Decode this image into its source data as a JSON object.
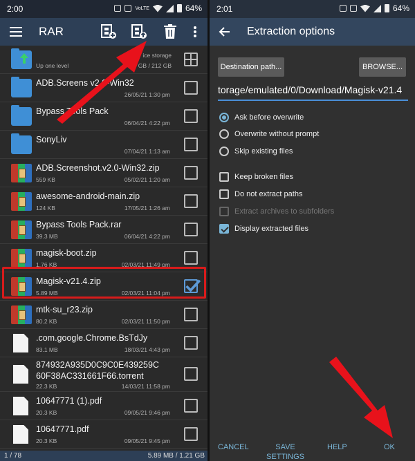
{
  "left": {
    "status": {
      "time": "2:00",
      "battery": "64%",
      "volte": "VoLTE"
    },
    "appbar": {
      "title": "RAR"
    },
    "files": [
      {
        "name": "",
        "sub": "Up one level",
        "info": "ice storage",
        "info2": "5 GB / 212 GB",
        "type": "up"
      },
      {
        "name": "ADB.Screens     v2.0-Win32",
        "sub": "",
        "date": "26/05/21 1:30 pm",
        "type": "folder"
      },
      {
        "name": "Bypass Tools Pack",
        "sub": "",
        "date": "06/04/21 4:22 pm",
        "type": "folder"
      },
      {
        "name": "SonyLiv",
        "sub": "",
        "date": "07/04/21 1:13 am",
        "type": "folder"
      },
      {
        "name": "ADB.Screenshot.v2.0-Win32.zip",
        "sub": "559 KB",
        "date": "05/02/21 1:20 am",
        "type": "rar"
      },
      {
        "name": "awesome-android-main.zip",
        "sub": "124 KB",
        "date": "17/05/21 1:26 am",
        "type": "rar"
      },
      {
        "name": "Bypass Tools Pack.rar",
        "sub": "39.3 MB",
        "date": "06/04/21 4:22 pm",
        "type": "rar"
      },
      {
        "name": "magisk-boot.zip",
        "sub": "1.76 KB",
        "date": "02/03/21 11:49 pm",
        "type": "rar"
      },
      {
        "name": "Magisk-v21.4.zip",
        "sub": "5.89 MB",
        "date": "02/03/21 11:04 pm",
        "type": "rar",
        "checked": true
      },
      {
        "name": "mtk-su_r23.zip",
        "sub": "80.2 KB",
        "date": "02/03/21 11:50 pm",
        "type": "rar"
      },
      {
        "name": ".com.google.Chrome.BsTdJy",
        "sub": "83.1 MB",
        "date": "18/03/21 4:43 pm",
        "type": "doc"
      },
      {
        "name": "874932A935D0C9C0E439259C",
        "name2": "60F38AC331661F66.torrent",
        "sub": "22.3 KB",
        "date": "14/03/21 11:58 pm",
        "type": "doc"
      },
      {
        "name": "10647771 (1).pdf",
        "sub": "20.3 KB",
        "date": "09/05/21 9:46 pm",
        "type": "doc"
      },
      {
        "name": "10647771.pdf",
        "sub": "20.3 KB",
        "date": "09/05/21 9:45 pm",
        "type": "doc"
      }
    ],
    "bottom": {
      "count": "1 / 78",
      "size": "5.89 MB / 1.21 GB"
    }
  },
  "right": {
    "status": {
      "time": "2:01",
      "battery": "64%"
    },
    "appbar": {
      "title": "Extraction options"
    },
    "dest_button": "Destination path...",
    "browse_button": "BROWSE...",
    "path": "torage/emulated/0/Download/Magisk-v21.4",
    "radios": [
      {
        "label": "Ask before overwrite",
        "selected": true
      },
      {
        "label": "Overwrite without prompt",
        "selected": false
      },
      {
        "label": "Skip existing files",
        "selected": false
      }
    ],
    "checks": [
      {
        "label": "Keep broken files",
        "checked": false
      },
      {
        "label": "Do not extract paths",
        "checked": false
      },
      {
        "label": "Extract archives to subfolders",
        "checked": false,
        "disabled": true
      },
      {
        "label": "Display extracted files",
        "checked": true
      }
    ],
    "footer": {
      "cancel": "CANCEL",
      "save1": "SAVE",
      "save2": "SETTINGS",
      "help": "HELP",
      "ok": "OK"
    }
  },
  "colors": {
    "accent": "#7ab6d8",
    "arrow": "#e8121b",
    "highlight": "#d81b1b",
    "appbar": "#2d3f56"
  },
  "icons": [
    "menu-icon",
    "add-to-archive-icon",
    "extract-icon",
    "delete-icon",
    "more-icon",
    "back-icon",
    "grid-icon",
    "folder-icon",
    "rar-archive-icon",
    "document-icon"
  ]
}
